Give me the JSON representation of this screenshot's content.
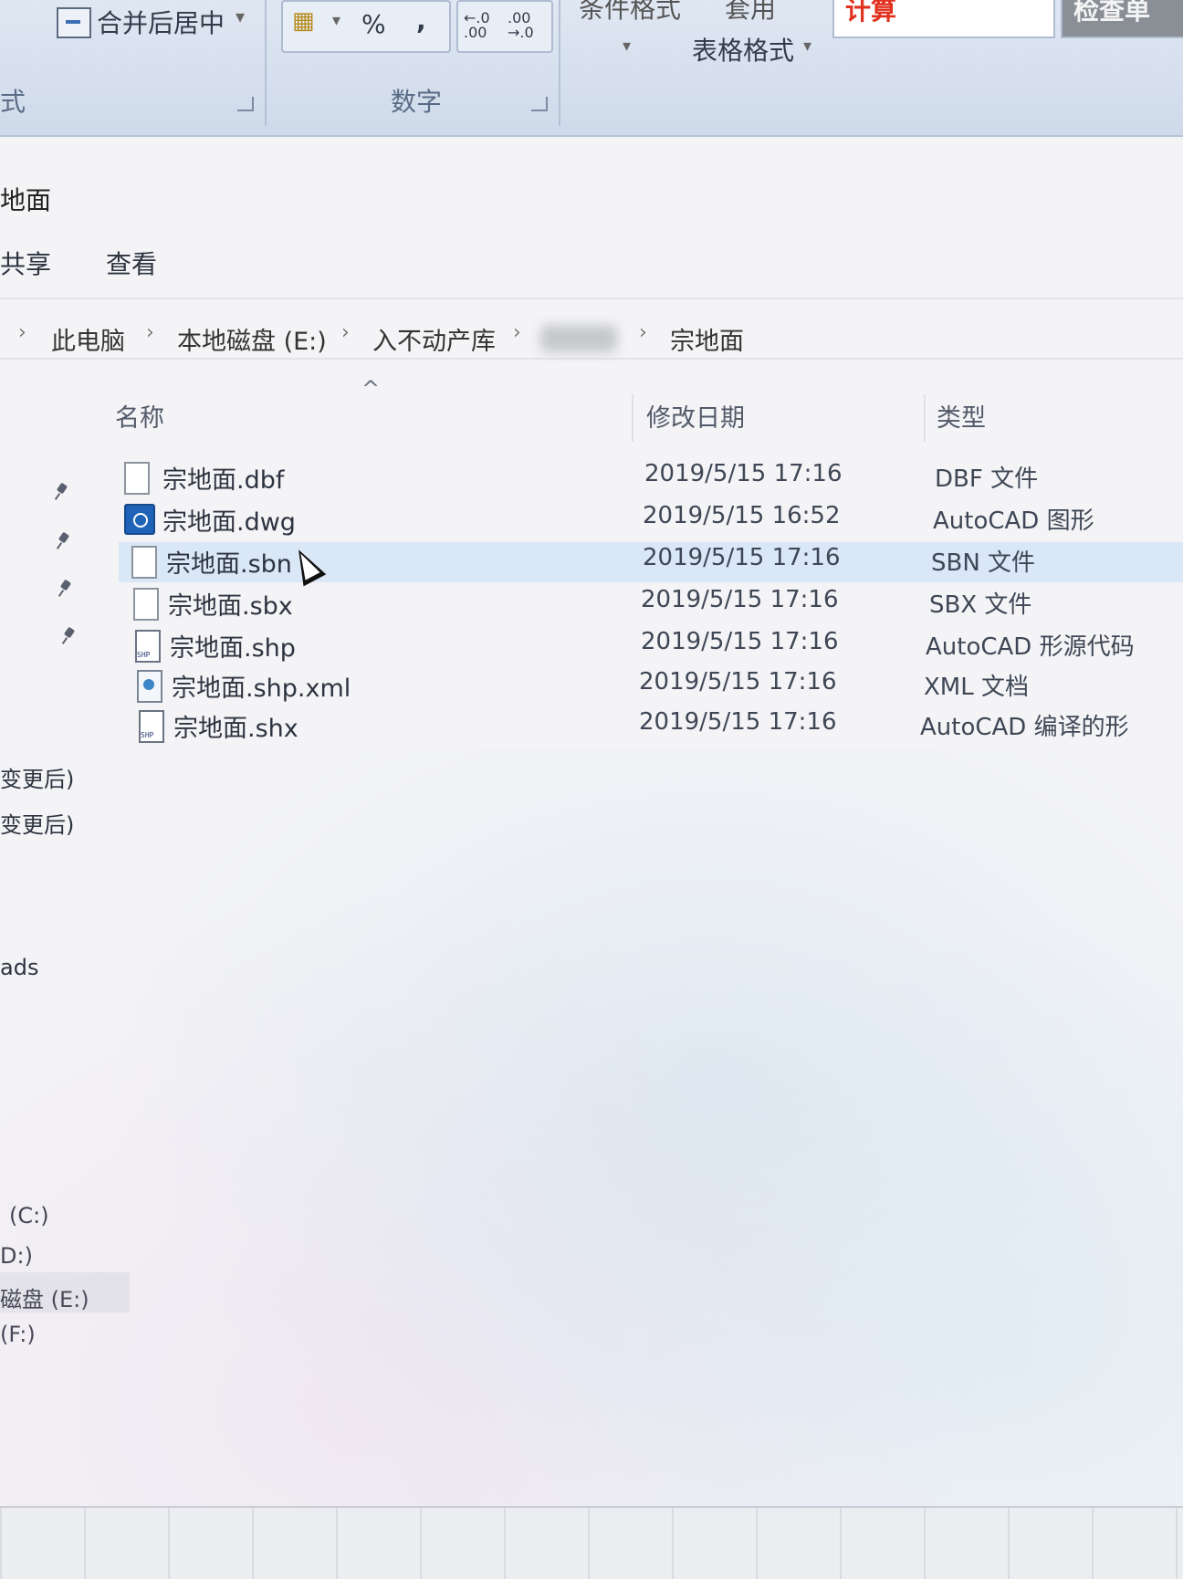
{
  "excel_ribbon": {
    "merge_center_label": "合并后居中",
    "alignment_group_label": "式",
    "number_group_label": "数字",
    "percent_symbol": "%",
    "comma_symbol": ",",
    "increase_decimal": "←.0 .00",
    "decrease_decimal": ".00 →.0",
    "conditional_format_label": "条件格式",
    "apply_label": "套用",
    "table_format_label": "表格格式",
    "style_calc_label": "计算",
    "style_check_label": "检查单"
  },
  "explorer": {
    "window_title": "地面",
    "menu": {
      "share": "共享",
      "view": "查看"
    },
    "breadcrumb": [
      "此电脑",
      "本地磁盘 (E:)",
      "入不动产库",
      "",
      "宗地面"
    ],
    "columns": {
      "name": "名称",
      "modified": "修改日期",
      "type": "类型"
    },
    "files": [
      {
        "name": "宗地面.dbf",
        "date": "2019/5/15 17:16",
        "type": "DBF 文件",
        "icon": "blank-file-icon"
      },
      {
        "name": "宗地面.dwg",
        "date": "2019/5/15 16:52",
        "type": "AutoCAD 图形",
        "icon": "autocad-drawing-icon"
      },
      {
        "name": "宗地面.sbn",
        "date": "2019/5/15 17:16",
        "type": "SBN 文件",
        "icon": "blank-file-icon"
      },
      {
        "name": "宗地面.sbx",
        "date": "2019/5/15 17:16",
        "type": "SBX 文件",
        "icon": "blank-file-icon"
      },
      {
        "name": "宗地面.shp",
        "date": "2019/5/15 17:16",
        "type": "AutoCAD 形源代码",
        "icon": "shp-file-icon"
      },
      {
        "name": "宗地面.shp.xml",
        "date": "2019/5/15 17:16",
        "type": "XML 文档",
        "icon": "xml-file-icon"
      },
      {
        "name": "宗地面.shx",
        "date": "2019/5/15 17:16",
        "type": "AutoCAD 编译的形",
        "icon": "shx-file-icon"
      }
    ],
    "sidebar": {
      "recent_1": "变更后)",
      "recent_2": "变更后)",
      "downloads": "ads",
      "drive_c": "(C:)",
      "drive_d": "D:)",
      "drive_e": "磁盘 (E:)",
      "drive_f": "(F:)"
    }
  }
}
